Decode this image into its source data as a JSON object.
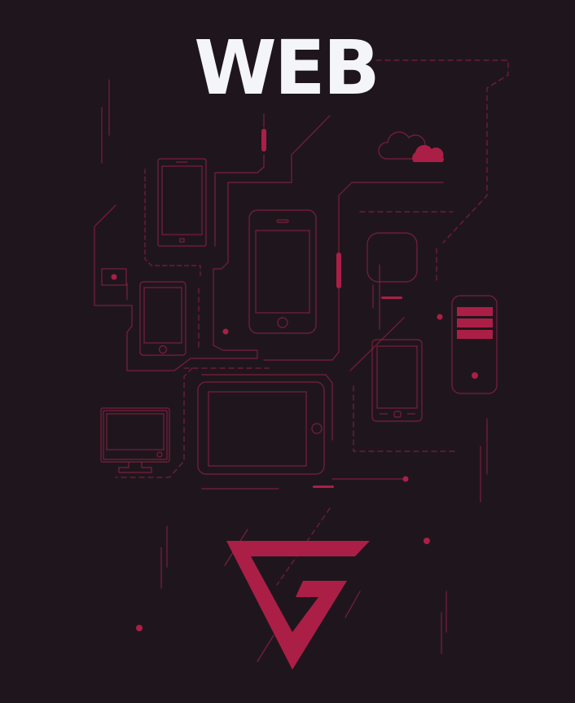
{
  "poster": {
    "title": "WEB",
    "background_color": "#1f161d",
    "accent_color": "#ab1f47",
    "line_color": "#7a1f3d",
    "title_color": "#f4f5f8"
  },
  "logo": {
    "shape": "triangle-g-logo"
  },
  "icons": [
    "cloud-icon",
    "windows-phone-icon",
    "iphone-icon",
    "small-phone-icon",
    "android-phone-icon",
    "tablet-icon",
    "desktop-monitor-icon",
    "server-icon",
    "rounded-square-icon"
  ]
}
